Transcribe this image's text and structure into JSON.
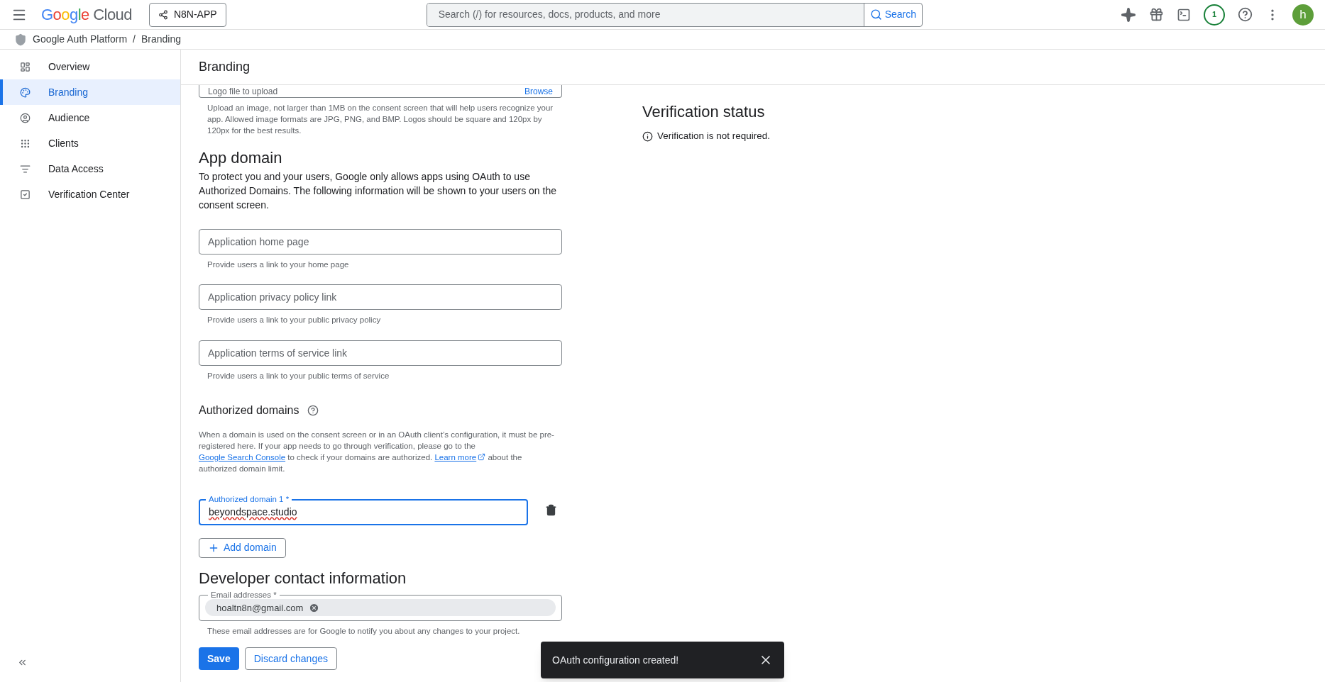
{
  "topbar": {
    "product": "Google Cloud",
    "project": "N8N-APP",
    "search": {
      "placeholder": "Search (/) for resources, docs, products, and more"
    },
    "search_button": "Search",
    "notifications": "1",
    "avatar": "h"
  },
  "breadcrumb": {
    "items": [
      "Google Auth Platform",
      "Branding"
    ],
    "separator": "/"
  },
  "sidebar": {
    "items": [
      {
        "label": "Overview",
        "kind": "overview",
        "selected": false
      },
      {
        "label": "Branding",
        "kind": "branding",
        "selected": true
      },
      {
        "label": "Audience",
        "kind": "audience",
        "selected": false
      },
      {
        "label": "Clients",
        "kind": "clients",
        "selected": false
      },
      {
        "label": "Data Access",
        "kind": "data",
        "selected": false
      },
      {
        "label": "Verification Center",
        "kind": "verification",
        "selected": false
      }
    ]
  },
  "page_title": "Branding",
  "logo_field": {
    "placeholder": "Logo file to upload",
    "action": "Browse",
    "hint": "Upload an image, not larger than 1MB on the consent screen that will help users recognize your app. Allowed image formats are JPG, PNG, and BMP. Logos should be square and 120px by 120px for the best results."
  },
  "app_domain": {
    "title": "App domain",
    "description": "To protect you and your users, Google only allows apps using OAuth to use Authorized Domains. The following information will be shown to your users on the consent screen.",
    "fields": [
      {
        "placeholder": "Application home page",
        "hint": "Provide users a link to your home page"
      },
      {
        "placeholder": "Application privacy policy link",
        "hint": "Provide users a link to your public privacy policy"
      },
      {
        "placeholder": "Application terms of service link",
        "hint": "Provide users a link to your public terms of service"
      }
    ]
  },
  "authorized_domains": {
    "title": "Authorized domains",
    "description": [
      {
        "kind": "text",
        "text": "When a domain is used on the consent screen or in an OAuth client’s configuration, it must be pre-registered here. If your app needs to go through verification, please go to the "
      },
      {
        "kind": "link",
        "text": "Google Search Console"
      },
      {
        "kind": "text",
        "text": " to check if your domains are authorized. "
      },
      {
        "kind": "external_link",
        "text": "Learn more"
      },
      {
        "kind": "text",
        "text": " about the authorized domain limit."
      }
    ],
    "domains": [
      {
        "label": "Authorized domain 1 *",
        "value": "beyondspace.studio",
        "focused": true
      }
    ],
    "add_button": "Add domain"
  },
  "developer_contact": {
    "title": "Developer contact information",
    "field_label": "Email addresses *",
    "chips": [
      "hoaltn8n@gmail.com"
    ],
    "hint": "These email addresses are for Google to notify you about any changes to your project."
  },
  "actions": {
    "save": "Save",
    "discard": "Discard changes"
  },
  "verification": {
    "title": "Verification status",
    "message": "Verification is not required."
  },
  "toast": {
    "message": "OAuth configuration created!"
  }
}
